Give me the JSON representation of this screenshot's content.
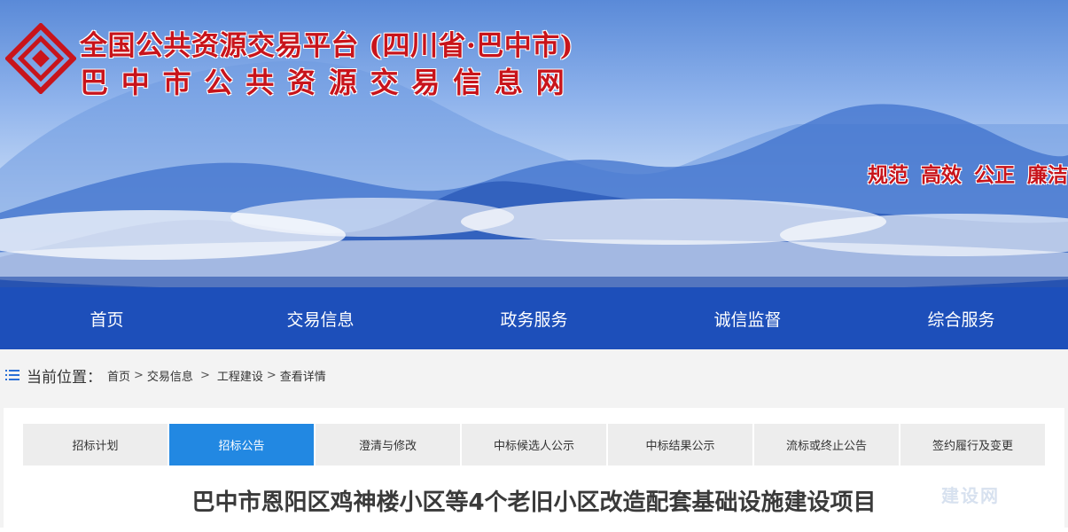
{
  "header": {
    "title_line1": "全国公共资源交易平台 (四川省·巴中市)",
    "title_line2": "巴中市公共资源交易信息网",
    "slogans": [
      "规范",
      "高效",
      "公正",
      "廉洁"
    ],
    "brand_color": "#c8141b"
  },
  "nav": {
    "items": [
      "首页",
      "交易信息",
      "政务服务",
      "诚信监督",
      "综合服务"
    ],
    "color": "#1d4fba"
  },
  "breadcrumb": {
    "label": "当前位置：",
    "items": [
      "首页",
      "交易信息",
      "工程建设",
      "查看详情"
    ]
  },
  "tabs": {
    "items": [
      "招标计划",
      "招标公告",
      "澄清与修改",
      "中标候选人公示",
      "中标结果公示",
      "流标或终止公告",
      "签约履行及变更"
    ],
    "active_index": 1,
    "active_color": "#2288e2"
  },
  "article": {
    "title": "巴中市恩阳区鸡神楼小区等4个老旧小区改造配套基础设施建设项目"
  },
  "watermark": "建设网"
}
